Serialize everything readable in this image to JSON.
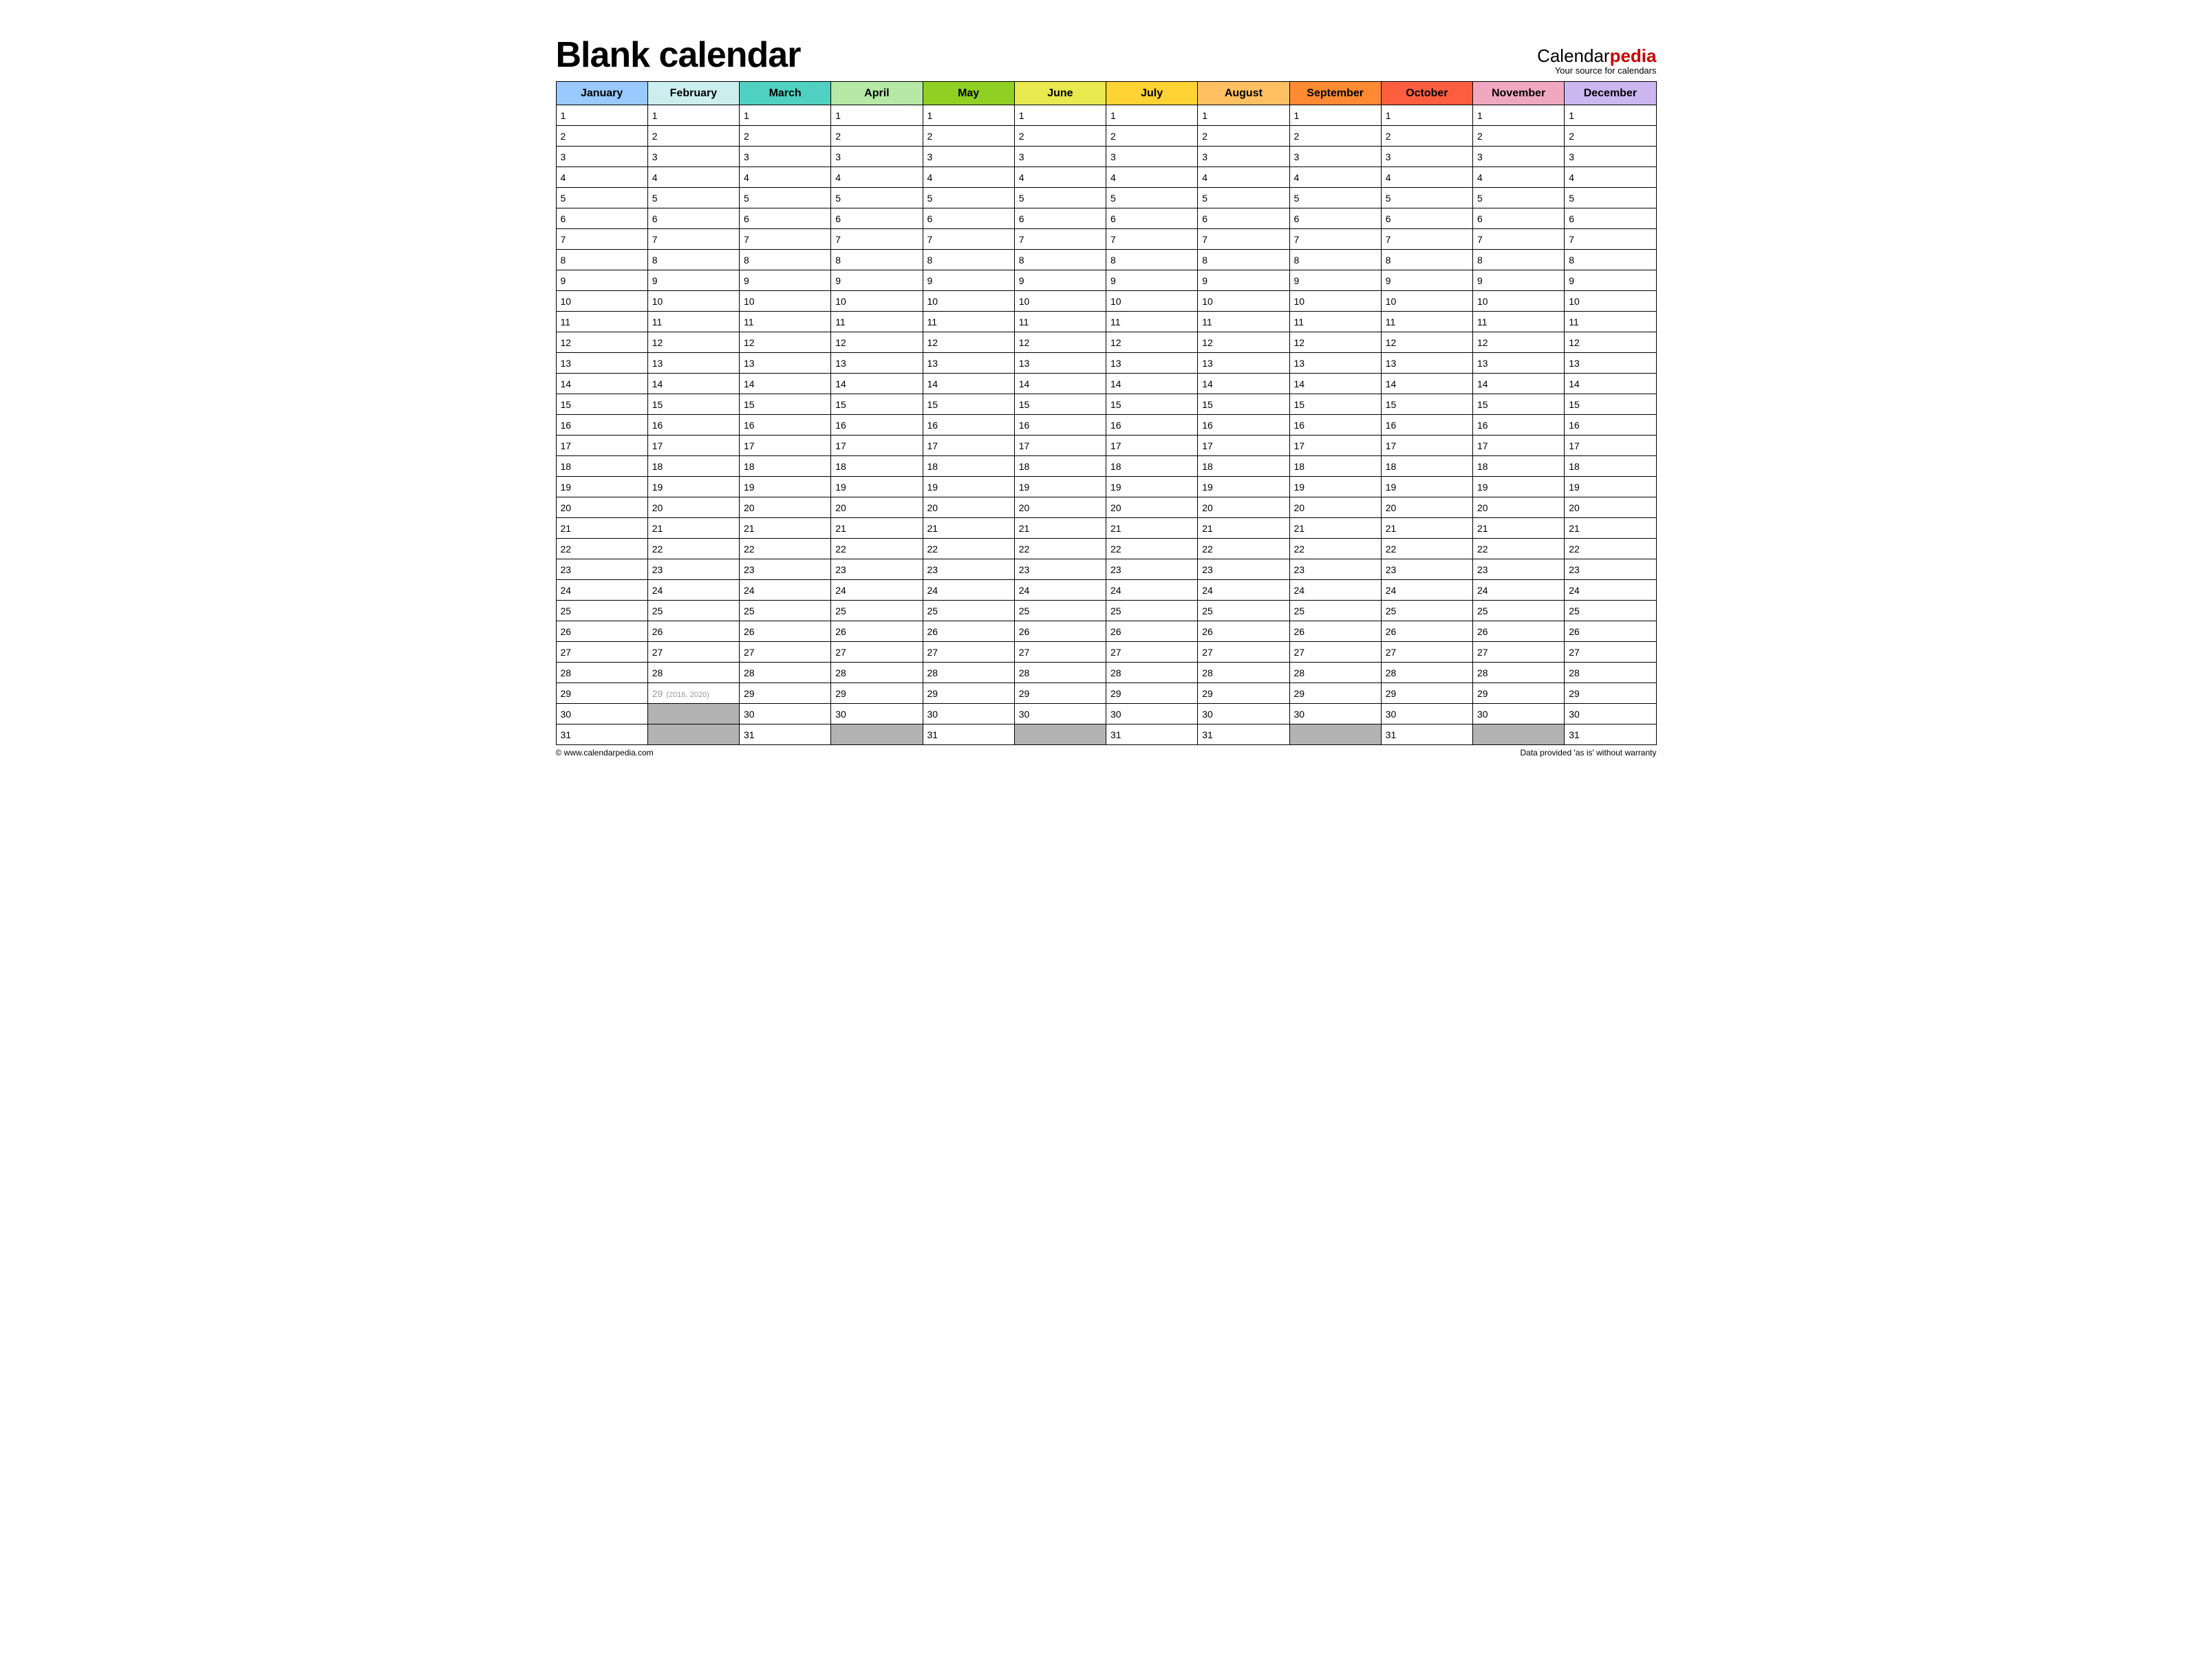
{
  "title": "Blank calendar",
  "brand": {
    "part1": "Calendar",
    "part2": "pedia",
    "tagline": "Your source for calendars"
  },
  "months": [
    {
      "name": "January",
      "color": "#99c9ff",
      "days": 31
    },
    {
      "name": "February",
      "color": "#cceeee",
      "days": 29,
      "day29_note": "(2016, 2020)"
    },
    {
      "name": "March",
      "color": "#4fd0c0",
      "days": 31
    },
    {
      "name": "April",
      "color": "#b6e8a6",
      "days": 30
    },
    {
      "name": "May",
      "color": "#8fd022",
      "days": 31
    },
    {
      "name": "June",
      "color": "#e8e84f",
      "days": 30
    },
    {
      "name": "July",
      "color": "#ffd333",
      "days": 31
    },
    {
      "name": "August",
      "color": "#ffc063",
      "days": 31
    },
    {
      "name": "September",
      "color": "#ff8a33",
      "days": 30
    },
    {
      "name": "October",
      "color": "#ff5d40",
      "days": 31
    },
    {
      "name": "November",
      "color": "#f0a8c0",
      "days": 30
    },
    {
      "name": "December",
      "color": "#cbb6f0",
      "days": 31
    }
  ],
  "max_days": 31,
  "footer": {
    "left": "© www.calendarpedia.com",
    "right": "Data provided 'as is' without warranty"
  }
}
